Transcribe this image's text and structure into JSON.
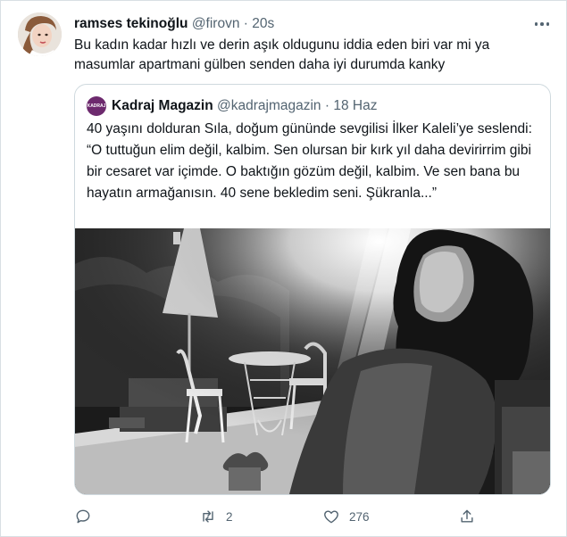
{
  "tweet": {
    "author_name": "ramses tekinoğlu",
    "handle": "@firovn",
    "separator": "·",
    "time": "20s",
    "text": "Bu kadın kadar hızlı ve derin aşık oldugunu iddia eden biri var mi ya masumlar apartmani gülben senden daha iyi durumda kanky"
  },
  "quoted": {
    "author_name": "Kadraj Magazin",
    "handle": "@kadrajmagazin",
    "separator": "·",
    "time": "18 Haz",
    "text": "40 yaşını dolduran Sıla, doğum gününde sevgilisi İlker Kaleli’ye seslendi: “O tuttuğun elim değil, kalbim. Sen olursan bir kırk yıl daha devirirrim gibi bir cesaret var içimde. O baktığın gözüm değil, kalbim. Ve sen bana bu hayatın armağanısın. 40 sene bekledim seni. Şükranla...”",
    "avatar_text": "KADRAJ"
  },
  "actions": {
    "reply_icon": "reply-icon",
    "retweet_icon": "retweet-icon",
    "retweet_count": "2",
    "like_icon": "heart-icon",
    "like_count": "276",
    "share_icon": "share-icon"
  },
  "colors": {
    "text": "#0f1419",
    "muted": "#536471",
    "border": "#cfd9de",
    "quote_avatar": "#6d2a6e"
  }
}
